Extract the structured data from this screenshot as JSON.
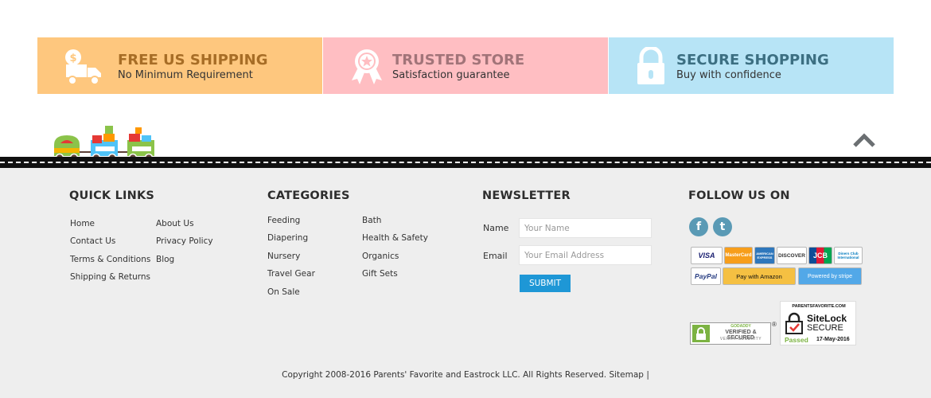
{
  "banner": [
    {
      "title": "FREE US SHIPPING",
      "subtitle": "No Minimum Requirement"
    },
    {
      "title": "TRUSTED STORE",
      "subtitle": "Satisfaction guarantee"
    },
    {
      "title": "SECURE SHOPPING",
      "subtitle": "Buy with confidence"
    }
  ],
  "footer": {
    "quick_links": {
      "title": "QUICK LINKS",
      "items": [
        "Home",
        "Contact Us",
        "Terms & Conditions",
        "Shipping & Returns",
        "About Us",
        "Privacy Policy",
        "Blog"
      ]
    },
    "categories": {
      "title": "CATEGORIES",
      "items": [
        "Feeding",
        "Diapering",
        "Nursery",
        "Travel Gear",
        "On Sale",
        "Bath",
        "Health & Safety",
        "Organics",
        "Gift Sets"
      ]
    },
    "newsletter": {
      "title": "NEWSLETTER",
      "name_label": "Name",
      "name_placeholder": "Your Name",
      "email_label": "Email",
      "email_placeholder": "Your Email Address",
      "submit_label": "SUBMIT"
    },
    "follow": {
      "title": "FOLLOW US ON",
      "facebook_glyph": "f",
      "twitter_glyph": "t"
    },
    "payment": {
      "visa": "VISA",
      "mastercard": "MasterCard",
      "amex": "AMERICAN EXPRESS",
      "discover": "DISCOVER",
      "jcb": "JCB",
      "diners": "Diners Club International",
      "paypal": "PayPal",
      "amazon": "Pay with Amazon",
      "stripe": "Powered by stripe"
    },
    "godaddy": {
      "brand": "GODADDY",
      "line1": "VERIFIED & SECURED",
      "line2": "VERIFY SECURITY",
      "registered": "®"
    },
    "sitelock": {
      "site": "PARENTSFAVORITE.COM",
      "brand": "SiteLock",
      "secure": "SECURE",
      "status": "Passed",
      "date": "17-May-2016"
    },
    "copyright": "Copyright 2008-2016 Parents' Favorite and Eastrock LLC. All Rights Reserved.",
    "sitemap": "Sitemap",
    "separator": "|"
  },
  "colors": {
    "shipping_bg": "#fec77e",
    "trusted_bg": "#ffbec2",
    "secure_bg": "#b7e4f6",
    "submit_bg": "#1e97d6",
    "footer_bg": "#eeeeee"
  }
}
